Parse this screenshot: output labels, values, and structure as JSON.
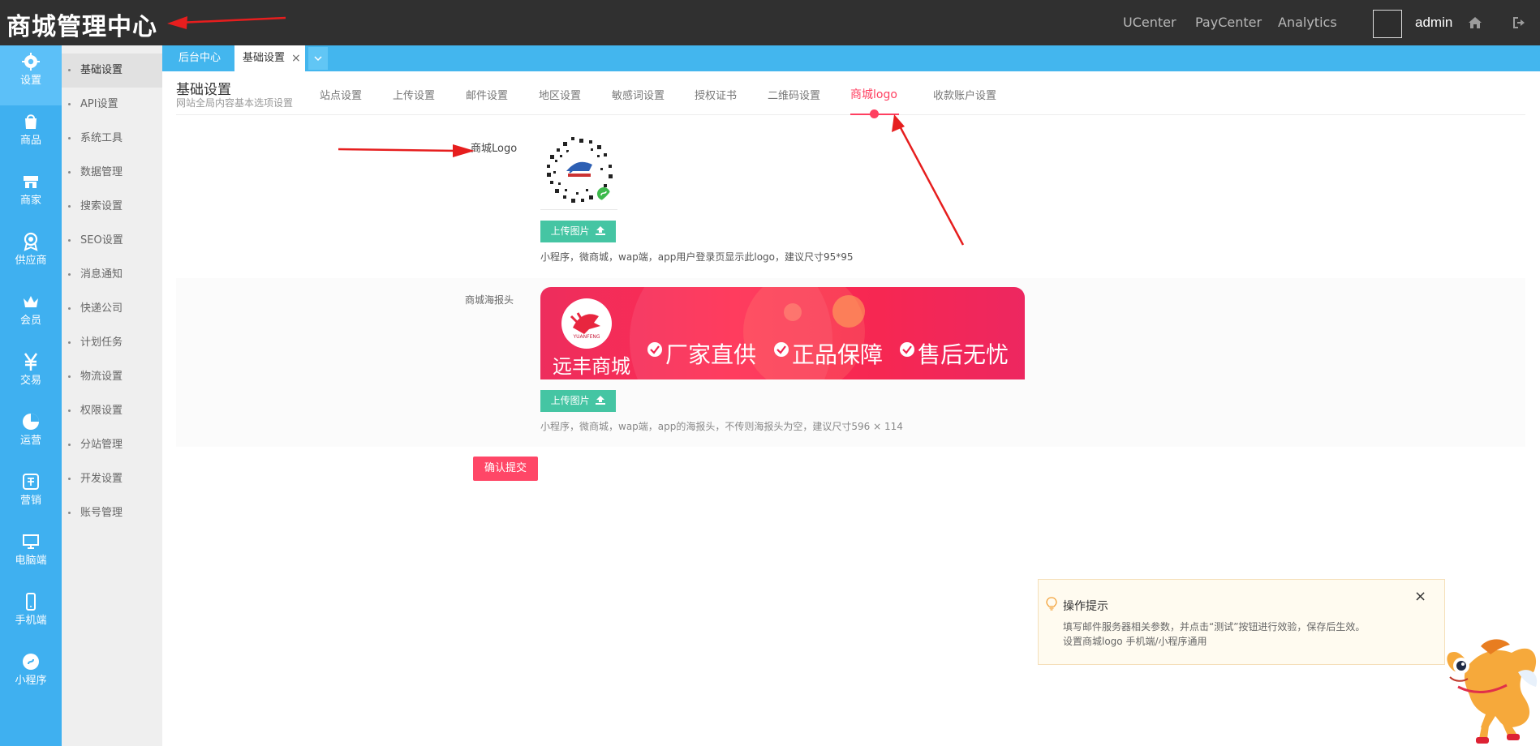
{
  "header": {
    "brand": "商城管理中心",
    "nav": [
      "UCenter",
      "PayCenter",
      "Analytics"
    ],
    "username": "admin",
    "icons": [
      "home-icon",
      "logout-icon"
    ]
  },
  "sidebar": {
    "items": [
      {
        "label": "设置",
        "icon": "gear-icon"
      },
      {
        "label": "商品",
        "icon": "bag-icon"
      },
      {
        "label": "商家",
        "icon": "store-icon"
      },
      {
        "label": "供应商",
        "icon": "badge-icon"
      },
      {
        "label": "会员",
        "icon": "crown-icon"
      },
      {
        "label": "交易",
        "icon": "yen-icon"
      },
      {
        "label": "运营",
        "icon": "pie-icon"
      },
      {
        "label": "营销",
        "icon": "promo-icon"
      },
      {
        "label": "电脑端",
        "icon": "monitor-icon"
      },
      {
        "label": "手机端",
        "icon": "phone-icon"
      },
      {
        "label": "小程序",
        "icon": "miniapp-icon"
      }
    ]
  },
  "subnav": {
    "items": [
      "基础设置",
      "API设置",
      "系统工具",
      "数据管理",
      "搜索设置",
      "SEO设置",
      "消息通知",
      "快递公司",
      "计划任务",
      "物流设置",
      "权限设置",
      "分站管理",
      "开发设置",
      "账号管理"
    ]
  },
  "tabs": {
    "items": [
      "后台中心",
      "基础设置"
    ],
    "close": "×"
  },
  "page": {
    "title": "基础设置",
    "subtitle": "网站全局内容基本选项设置",
    "settings_tabs": [
      "站点设置",
      "上传设置",
      "邮件设置",
      "地区设置",
      "敏感词设置",
      "授权证书",
      "二维码设置",
      "商城logo",
      "收款账户设置"
    ]
  },
  "form": {
    "logo_label": "商城Logo",
    "logo_upload": "上传图片",
    "logo_help": "小程序，微商城，wap端，app用户登录页显示此logo，建议尺寸95*95",
    "poster_label": "商城海报头",
    "poster_upload": "上传图片",
    "poster_help": "小程序，微商城，wap端，app的海报头，不传则海报头为空，建议尺寸596 × 114",
    "submit": "确认提交"
  },
  "poster": {
    "brand_text": "远丰商城",
    "logo_text": "YUANFENG",
    "slogans": [
      "厂家直供",
      "正品保障",
      "售后无忧"
    ]
  },
  "tip": {
    "title": "操作提示",
    "lines": [
      "填写邮件服务器相关参数，并点击“测试”按钮进行效验，保存后生效。",
      "设置商城logo 手机端/小程序通用"
    ],
    "close": "×"
  },
  "colors": {
    "topbar": "#303030",
    "sidebar": "#3fb0f0",
    "tabs_bar": "#43b6ee",
    "accent": "#ff3f60",
    "upload": "#45c5a3",
    "submit": "#ff4767"
  }
}
